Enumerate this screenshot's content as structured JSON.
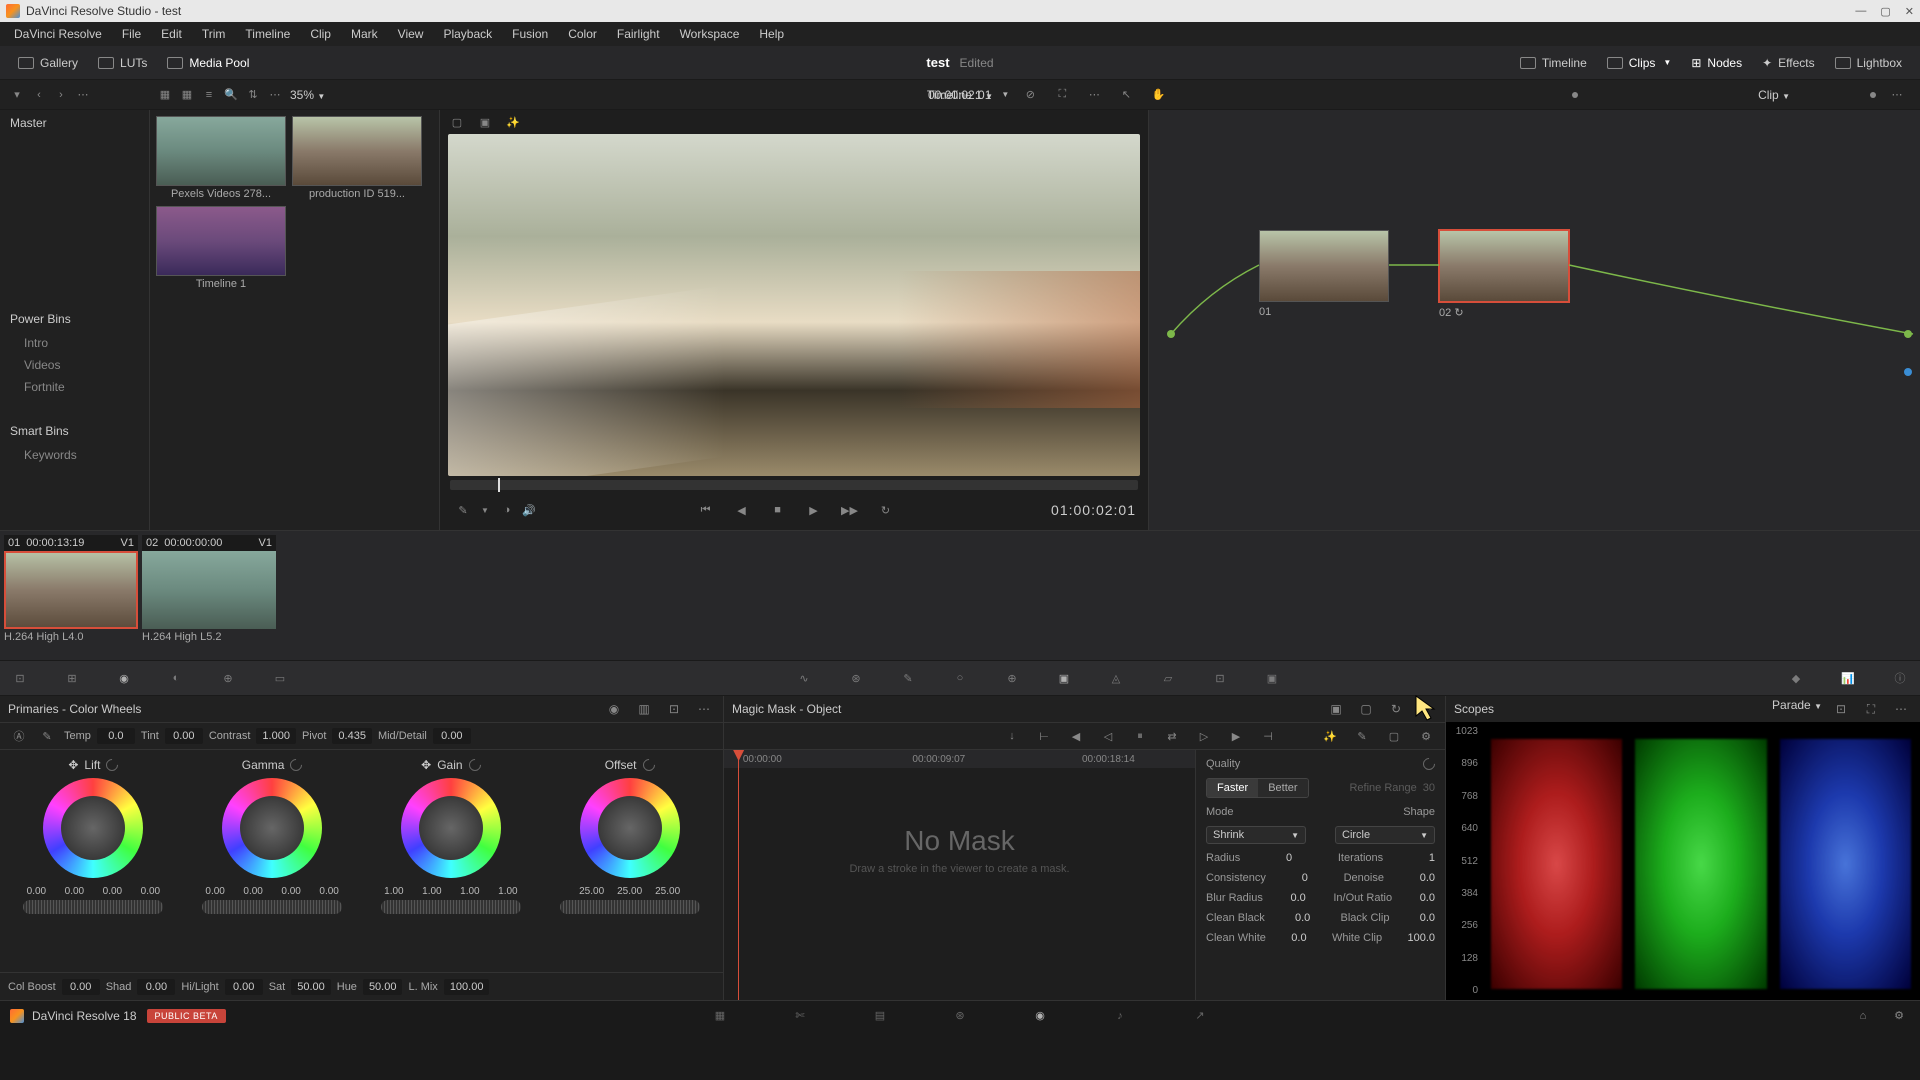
{
  "title": "DaVinci Resolve Studio - test",
  "project": {
    "name": "test",
    "status": "Edited"
  },
  "menu": [
    "DaVinci Resolve",
    "File",
    "Edit",
    "Trim",
    "Timeline",
    "Clip",
    "Mark",
    "View",
    "Playback",
    "Fusion",
    "Color",
    "Fairlight",
    "Workspace",
    "Help"
  ],
  "toolbar": {
    "gallery": "Gallery",
    "luts": "LUTs",
    "media_pool": "Media Pool",
    "timeline": "Timeline",
    "clips": "Clips",
    "nodes": "Nodes",
    "effects": "Effects",
    "lightbox": "Lightbox"
  },
  "subbar": {
    "zoom": "35%",
    "timeline_name": "Timeline 1",
    "timecode": "00:00:02:01",
    "clip_label": "Clip"
  },
  "bins": {
    "master": "Master",
    "power": "Power Bins",
    "power_items": [
      "Intro",
      "Videos",
      "Fortnite"
    ],
    "smart": "Smart Bins",
    "smart_items": [
      "Keywords"
    ]
  },
  "media_clips": [
    {
      "name": "Pexels Videos 278..."
    },
    {
      "name": "production ID 519..."
    },
    {
      "name": "Timeline 1"
    }
  ],
  "viewer": {
    "timecode": "01:00:02:01"
  },
  "nodes": [
    {
      "id": "01"
    },
    {
      "id": "02"
    }
  ],
  "timeline_clips": [
    {
      "idx": "01",
      "tc": "00:00:13:19",
      "track": "V1",
      "label": "H.264 High L4.0"
    },
    {
      "idx": "02",
      "tc": "00:00:00:00",
      "track": "V1",
      "label": "H.264 High L5.2"
    }
  ],
  "wheels_panel": {
    "title": "Primaries - Color Wheels",
    "adjustments": {
      "temp_label": "Temp",
      "temp": "0.0",
      "tint_label": "Tint",
      "tint": "0.00",
      "contrast_label": "Contrast",
      "contrast": "1.000",
      "pivot_label": "Pivot",
      "pivot": "0.435",
      "md_label": "Mid/Detail",
      "md": "0.00"
    },
    "wheels": {
      "lift": {
        "title": "Lift",
        "vals": [
          "0.00",
          "0.00",
          "0.00",
          "0.00"
        ]
      },
      "gamma": {
        "title": "Gamma",
        "vals": [
          "0.00",
          "0.00",
          "0.00",
          "0.00"
        ]
      },
      "gain": {
        "title": "Gain",
        "vals": [
          "1.00",
          "1.00",
          "1.00",
          "1.00"
        ]
      },
      "offset": {
        "title": "Offset",
        "vals": [
          "25.00",
          "25.00",
          "25.00"
        ]
      }
    },
    "adjustments2": {
      "colboost_label": "Col Boost",
      "colboost": "0.00",
      "shad_label": "Shad",
      "shad": "0.00",
      "hilight_label": "Hi/Light",
      "hilight": "0.00",
      "sat_label": "Sat",
      "sat": "50.00",
      "hue_label": "Hue",
      "hue": "50.00",
      "lmix_label": "L. Mix",
      "lmix": "100.00"
    }
  },
  "mask_panel": {
    "title": "Magic Mask - Object",
    "ruler": [
      "00:00:00",
      "00:00:09:07",
      "00:00:18:14"
    ],
    "empty_title": "No Mask",
    "empty_sub": "Draw a stroke in the viewer to create a mask.",
    "quality_label": "Quality",
    "faster": "Faster",
    "better": "Better",
    "refine_label": "Refine Range",
    "refine_val": "30",
    "mode_label": "Mode",
    "shape_label": "Shape",
    "mode_val": "Shrink",
    "shape_val": "Circle",
    "radius_label": "Radius",
    "radius": "0",
    "iterations_label": "Iterations",
    "iterations": "1",
    "consistency_label": "Consistency",
    "consistency": "0",
    "denoise_label": "Denoise",
    "denoise": "0.0",
    "blur_label": "Blur Radius",
    "blur": "0.0",
    "inout_label": "In/Out Ratio",
    "inout": "0.0",
    "cblack_label": "Clean Black",
    "cblack": "0.0",
    "bclip_label": "Black Clip",
    "bclip": "0.0",
    "cwhite_label": "Clean White",
    "cwhite": "0.0",
    "wclip_label": "White Clip",
    "wclip": "100.0"
  },
  "scopes": {
    "title": "Scopes",
    "mode": "Parade",
    "scale": [
      "1023",
      "896",
      "768",
      "640",
      "512",
      "384",
      "256",
      "128",
      "0"
    ]
  },
  "footer": {
    "app": "DaVinci Resolve 18",
    "badge": "PUBLIC BETA"
  }
}
